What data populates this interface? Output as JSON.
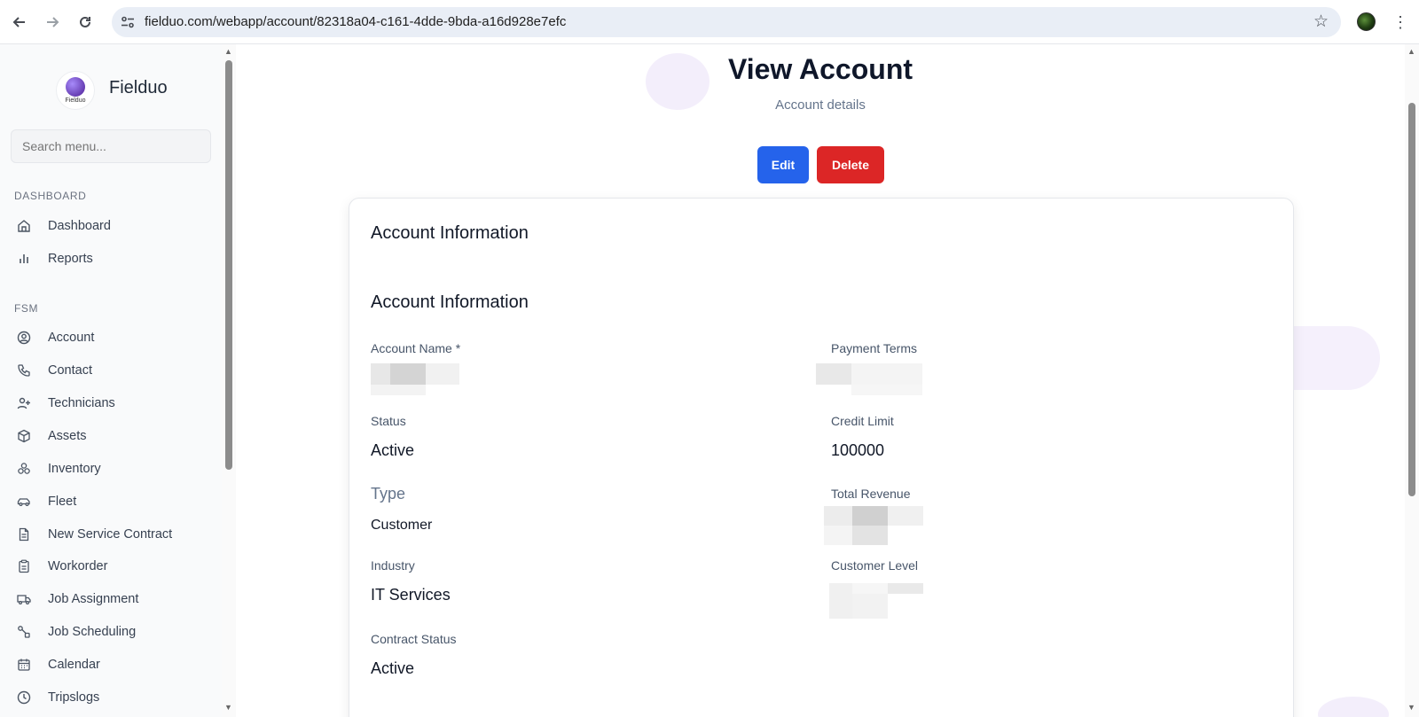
{
  "browser": {
    "url": "fielduo.com/webapp/account/82318a04-c161-4dde-9bda-a16d928e7efc"
  },
  "sidebar": {
    "brand_name": "Fielduo",
    "logo_text": "Fielduo",
    "search_placeholder": "Search menu...",
    "sections": [
      {
        "title": "DASHBOARD",
        "items": [
          {
            "label": "Dashboard",
            "icon": "home-icon"
          },
          {
            "label": "Reports",
            "icon": "bar-chart-icon"
          }
        ]
      },
      {
        "title": "FSM",
        "items": [
          {
            "label": "Account",
            "icon": "user-circle-icon"
          },
          {
            "label": "Contact",
            "icon": "phone-icon"
          },
          {
            "label": "Technicians",
            "icon": "user-plus-icon"
          },
          {
            "label": "Assets",
            "icon": "box-icon"
          },
          {
            "label": "Inventory",
            "icon": "boxes-icon"
          },
          {
            "label": "Fleet",
            "icon": "car-icon"
          },
          {
            "label": "New Service Contract",
            "icon": "document-icon"
          },
          {
            "label": "Workorder",
            "icon": "clipboard-icon"
          },
          {
            "label": "Job Assignment",
            "icon": "truck-icon"
          },
          {
            "label": "Job Scheduling",
            "icon": "route-icon"
          },
          {
            "label": "Calendar",
            "icon": "calendar-icon"
          },
          {
            "label": "Tripslogs",
            "icon": "clock-icon"
          }
        ]
      }
    ]
  },
  "main": {
    "title": "View Account",
    "subtitle": "Account details",
    "edit_label": "Edit",
    "delete_label": "Delete",
    "card": {
      "heading": "Account Information",
      "subheading": "Account Information",
      "fields": {
        "account_name_label": "Account Name *",
        "payment_terms_label": "Payment Terms",
        "status_label": "Status",
        "status_value": "Active",
        "credit_limit_label": "Credit Limit",
        "credit_limit_value": "100000",
        "type_label": "Type",
        "type_value": "Customer",
        "total_revenue_label": "Total Revenue",
        "industry_label": "Industry",
        "industry_value": "IT Services",
        "customer_level_label": "Customer Level",
        "contract_status_label": "Contract Status",
        "contract_status_value": "Active"
      }
    }
  },
  "colors": {
    "primary": "#2563eb",
    "danger": "#dc2626",
    "sidebar_bg": "#f9fafb"
  }
}
